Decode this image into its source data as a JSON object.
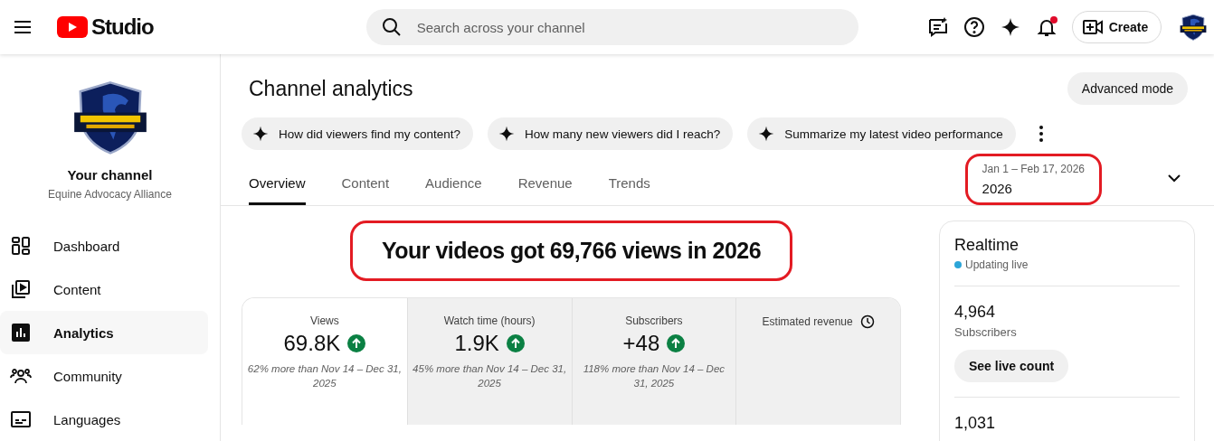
{
  "header": {
    "logo_text": "Studio",
    "search": {
      "placeholder": "Search across your channel"
    },
    "notifications_unread": true,
    "create_button": "Create"
  },
  "sidebar": {
    "channel": {
      "title": "Your channel",
      "name": "Equine Advocacy Alliance"
    },
    "items": [
      {
        "label": "Dashboard",
        "selected": false
      },
      {
        "label": "Content",
        "selected": false
      },
      {
        "label": "Analytics",
        "selected": true
      },
      {
        "label": "Community",
        "selected": false
      },
      {
        "label": "Languages",
        "selected": false
      }
    ]
  },
  "page": {
    "title": "Channel analytics",
    "advanced_button": "Advanced mode",
    "suggestions": [
      "How did viewers find my content?",
      "How many new viewers did I reach?",
      "Summarize my latest video performance"
    ],
    "tabs": [
      {
        "label": "Overview",
        "selected": true
      },
      {
        "label": "Content",
        "selected": false
      },
      {
        "label": "Audience",
        "selected": false
      },
      {
        "label": "Revenue",
        "selected": false
      },
      {
        "label": "Trends",
        "selected": false
      }
    ],
    "date_range": {
      "range": "Jan 1 – Feb 17, 2026",
      "value": "2026"
    },
    "headline": "Your videos got 69,766 views in 2026",
    "metrics": [
      {
        "kind": "value",
        "label": "Views",
        "value": "69.8K",
        "comparison": "62% more than Nov 14 – Dec 31, 2025",
        "selected": true
      },
      {
        "kind": "value",
        "label": "Watch time (hours)",
        "value": "1.9K",
        "comparison": "45% more than Nov 14 – Dec 31, 2025",
        "selected": false
      },
      {
        "kind": "value",
        "label": "Subscribers",
        "value": "+48",
        "comparison": "118% more than Nov 14 – Dec 31, 2025",
        "selected": false
      },
      {
        "kind": "pending",
        "label": "Estimated revenue",
        "selected": false
      }
    ]
  },
  "realtime": {
    "title": "Realtime",
    "status": "Updating live",
    "stats": [
      {
        "value": "4,964",
        "label": "Subscribers",
        "button": "See live count"
      },
      {
        "value": "1,031"
      }
    ]
  }
}
